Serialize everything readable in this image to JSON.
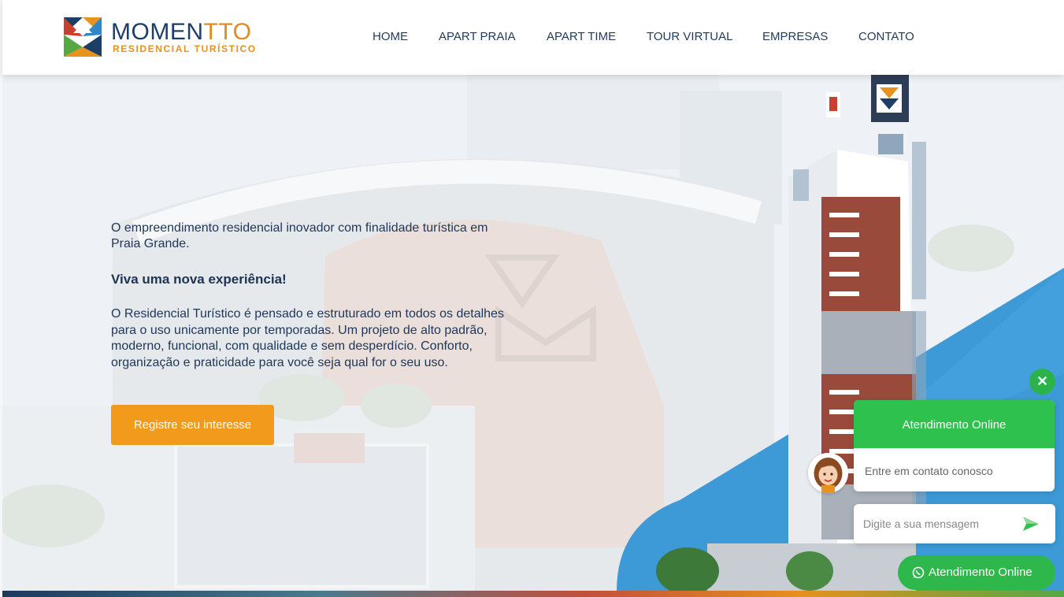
{
  "header": {
    "logo": {
      "name_part1": "MOMEN",
      "name_part2": "TTO",
      "tagline": "RESIDENCIAL TURÍSTICO"
    },
    "nav": [
      "HOME",
      "APART PRAIA",
      "APART TIME",
      "TOUR VIRTUAL",
      "EMPRESAS",
      "CONTATO"
    ]
  },
  "hero": {
    "intro": "O empreendimento residencial inovador com finalidade turística em Praia Grande.",
    "subtitle": "Viva uma nova experiência!",
    "description": "O Residencial Turístico é pensado e estruturado em todos os detalhes para o uso unicamente por temporadas. Um projeto de alto padrão, moderno, funcional, com qualidade e sem desperdício. Conforto, organização e praticidade para você seja qual for o seu uso.",
    "cta_label": "Registre seu interesse"
  },
  "chat": {
    "close_symbol": "✕",
    "title": "Atendimento Online",
    "subtitle": "Entre em contato conosco",
    "input_placeholder": "Digite a sua mensagem",
    "whatsapp_label": "Atendimento Online"
  },
  "colors": {
    "brand_navy": "#1d3f66",
    "brand_orange": "#f29a1c",
    "chat_green": "#2ec14d",
    "sky_blue": "#3d9ad6"
  },
  "icons": [
    "logo-mark-icon",
    "send-icon",
    "whatsapp-icon",
    "close-icon",
    "avatar-icon"
  ]
}
